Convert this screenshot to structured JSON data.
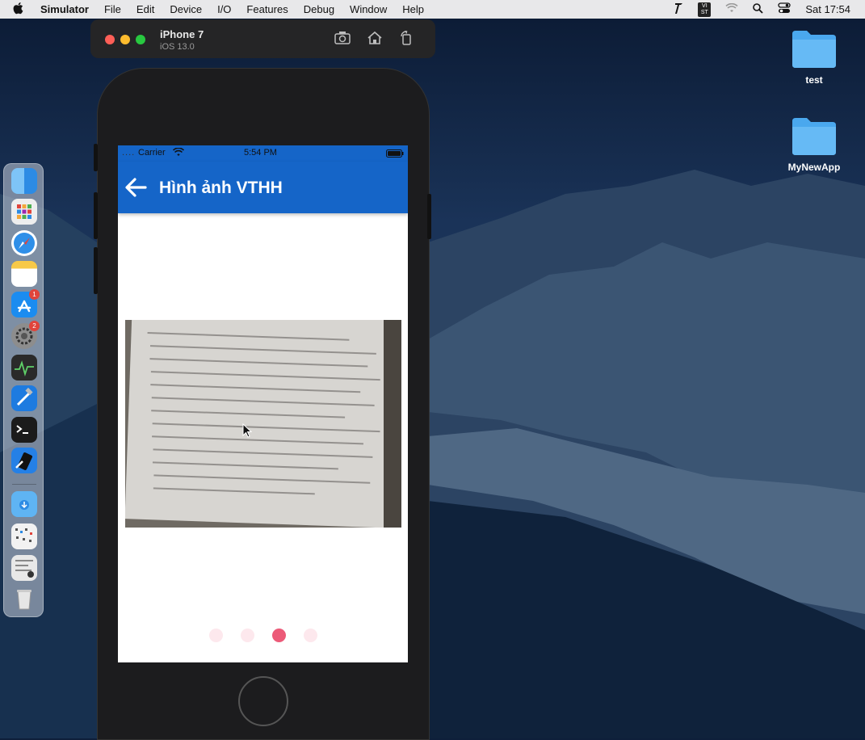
{
  "menubar": {
    "app_name": "Simulator",
    "items": [
      "File",
      "Edit",
      "Device",
      "I/O",
      "Features",
      "Debug",
      "Window",
      "Help"
    ],
    "clock": "Sat 17:54",
    "vi_badge": "VI\nST"
  },
  "simulator": {
    "device_name": "iPhone 7",
    "os_version": "iOS 13.0"
  },
  "phone_status": {
    "carrier": "Carrier",
    "time": "5:54 PM"
  },
  "app": {
    "title": "Hình ảnh VTHH",
    "pager": {
      "total": 4,
      "active_index": 2
    }
  },
  "desktop": {
    "icons": [
      {
        "label": "test"
      },
      {
        "label": "MyNewApp"
      }
    ]
  },
  "dock": {
    "badges": {
      "app_store": "1",
      "system_prefs": "2"
    }
  },
  "colors": {
    "app_bar": "#1565c8",
    "page_dot": "#fde8ed",
    "page_dot_active": "#ec5a78"
  }
}
